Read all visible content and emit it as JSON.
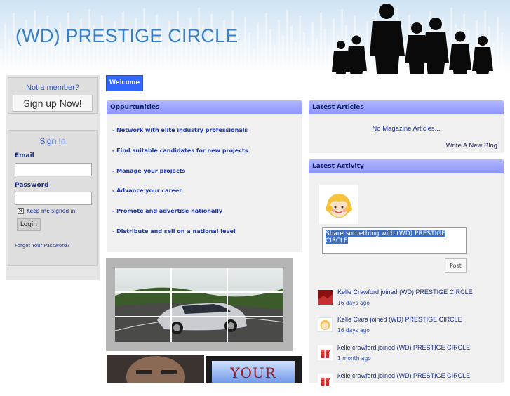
{
  "header": {
    "site_title": "(WD) PRESTIGE CIRCLE"
  },
  "member_panel": {
    "question": "Not a member?",
    "signup_label": "Sign up Now!"
  },
  "signin_panel": {
    "title": "Sign In",
    "email_label": "Email",
    "email_value": "",
    "password_label": "Password",
    "password_value": "",
    "keep_signed_in": "Keep me signed in",
    "keep_signed_in_checked": true,
    "login_label": "Login",
    "forgot_label": "Forgot Your Password?"
  },
  "main": {
    "welcome_tab": "Welcome",
    "opportunities": {
      "title": "Oppurtunities",
      "items": [
        "- Network with elite industry professionals",
        "- Find suitable candidates for new projects",
        "- Manage your projects",
        "- Advance your career",
        "- Promote and advertise nationally",
        "- Distribute and sell on a national level"
      ]
    }
  },
  "articles": {
    "title": "Latest Articles",
    "empty_text": "No Magazine Articles...",
    "write_blog_label": "Write A New Blog"
  },
  "activity": {
    "title": "Latest Activity",
    "share_placeholder": "Share something with (WD) PRESTIGE CIRCLE",
    "post_label": "Post",
    "items": [
      {
        "who": "Kelle Crawford",
        "action": "joined (WD) PRESTIGE CIRCLE",
        "time": "16 days ago",
        "thumb": "red-landscape-thumb"
      },
      {
        "who": "Kelle Ciara",
        "action": "joined (WD) PRESTIGE CIRCLE",
        "time": "16 days ago",
        "thumb": "cartoon-face-thumb"
      },
      {
        "who": "kelle crawford",
        "action": "joined (WD) PRESTIGE CIRCLE",
        "time": "1 month ago",
        "thumb": "gift-icon"
      },
      {
        "who": "kelle crawford",
        "action": "joined (WD) PRESTIGE CIRCLE",
        "time": "",
        "thumb": "gift-icon"
      }
    ]
  },
  "promo": {
    "banner_text": "YOUR"
  },
  "colors": {
    "accent": "#3366ff",
    "title_blue": "#3a7fc4",
    "link_blue": "#1a35b0",
    "box_header": "#9aa1ff"
  }
}
